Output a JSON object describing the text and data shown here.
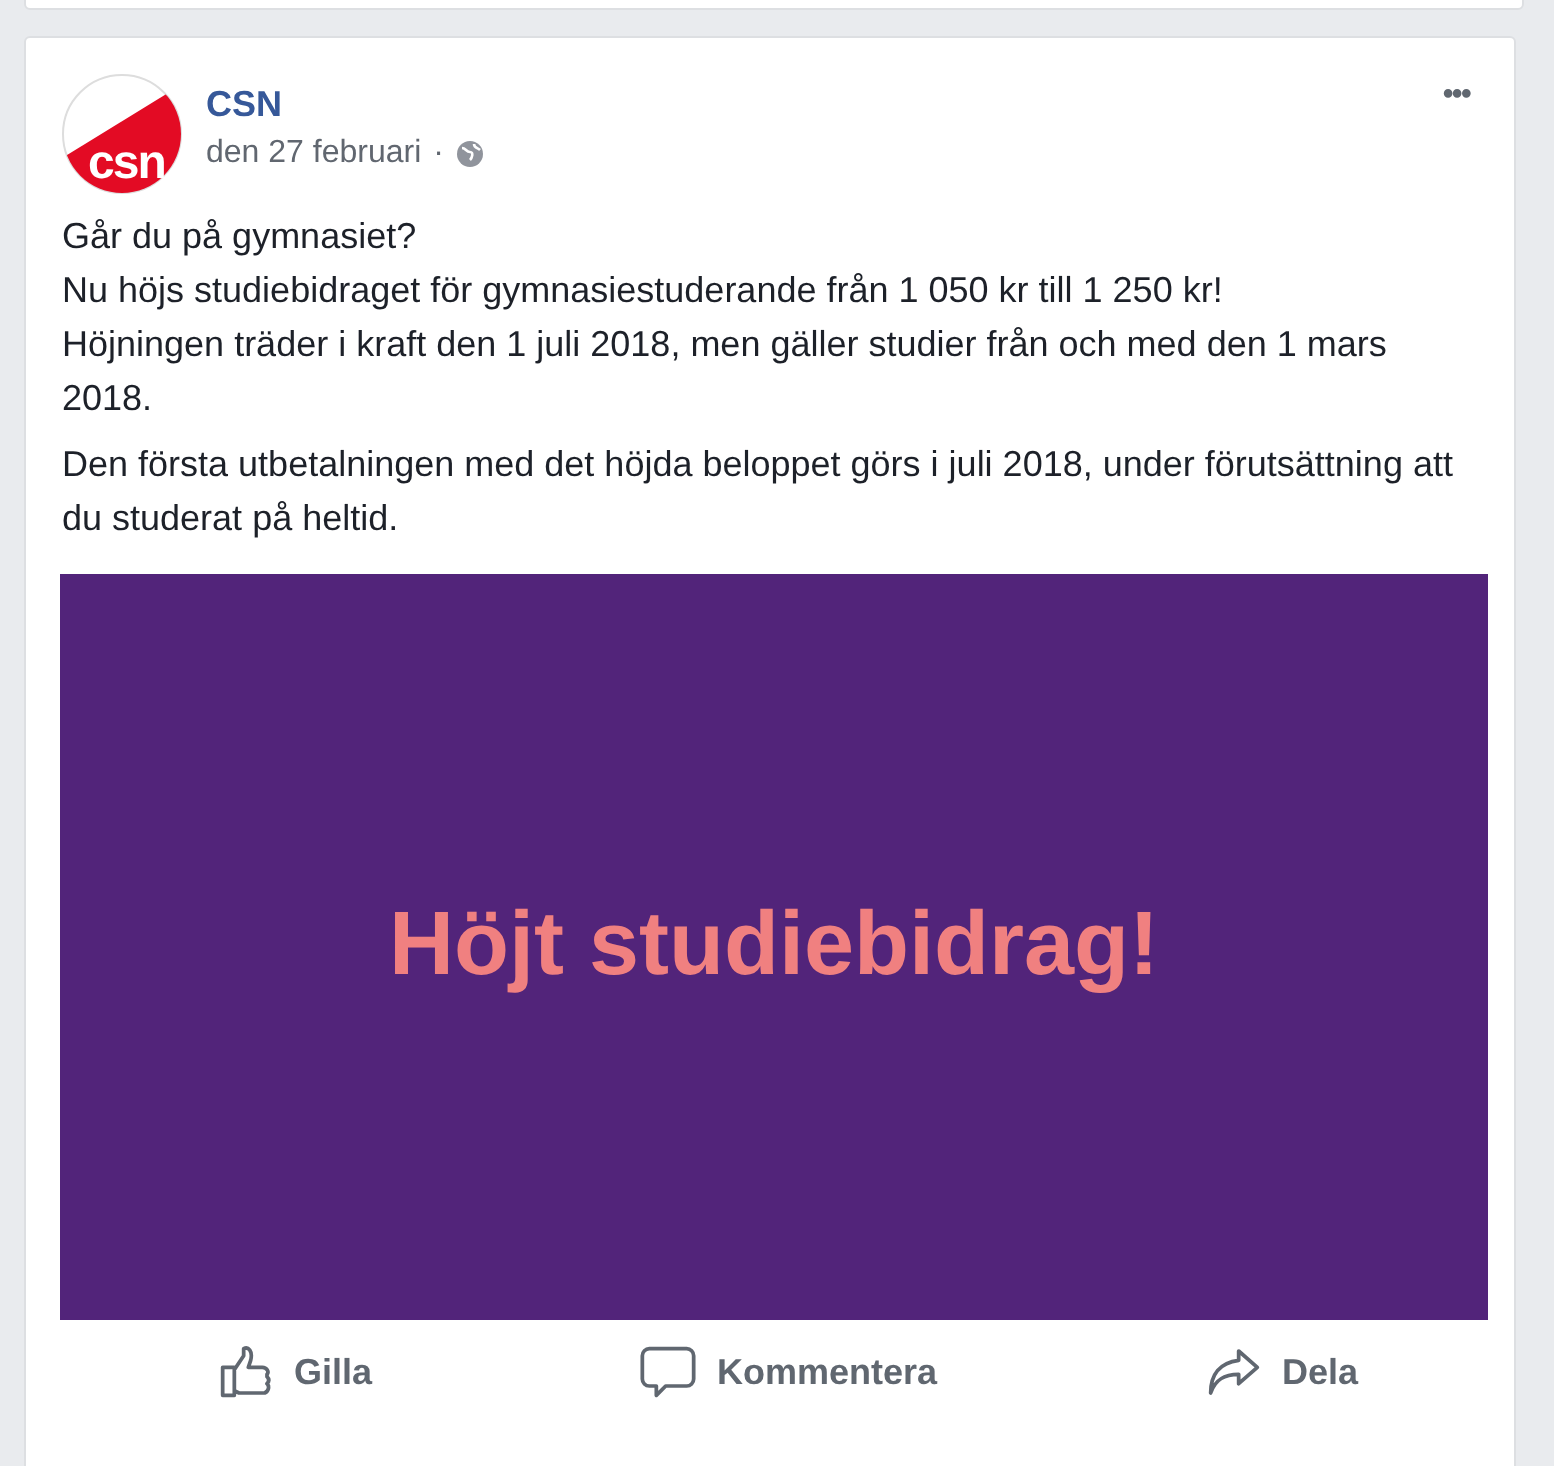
{
  "post": {
    "logo_text": "csn",
    "author": "CSN",
    "date": "den 27 februari",
    "separator": "·",
    "menu": "•••",
    "paragraphs": [
      "Går du på gymnasiet?\nNu höjs studiebidraget för gymnasiestuderande från 1 050 kr till 1 250 kr!\nHöjningen träder i kraft den 1 juli 2018, men gäller studier från och med den 1 mars 2018.",
      "Den första utbetalningen med det höjda beloppet görs i juli 2018, under förutsättning att du studerat på heltid."
    ],
    "image_text": "Höjt studiebidrag!",
    "actions": [
      {
        "kind": "like",
        "label": "Gilla"
      },
      {
        "kind": "comment",
        "label": "Kommentera"
      },
      {
        "kind": "share",
        "label": "Dela"
      }
    ]
  }
}
